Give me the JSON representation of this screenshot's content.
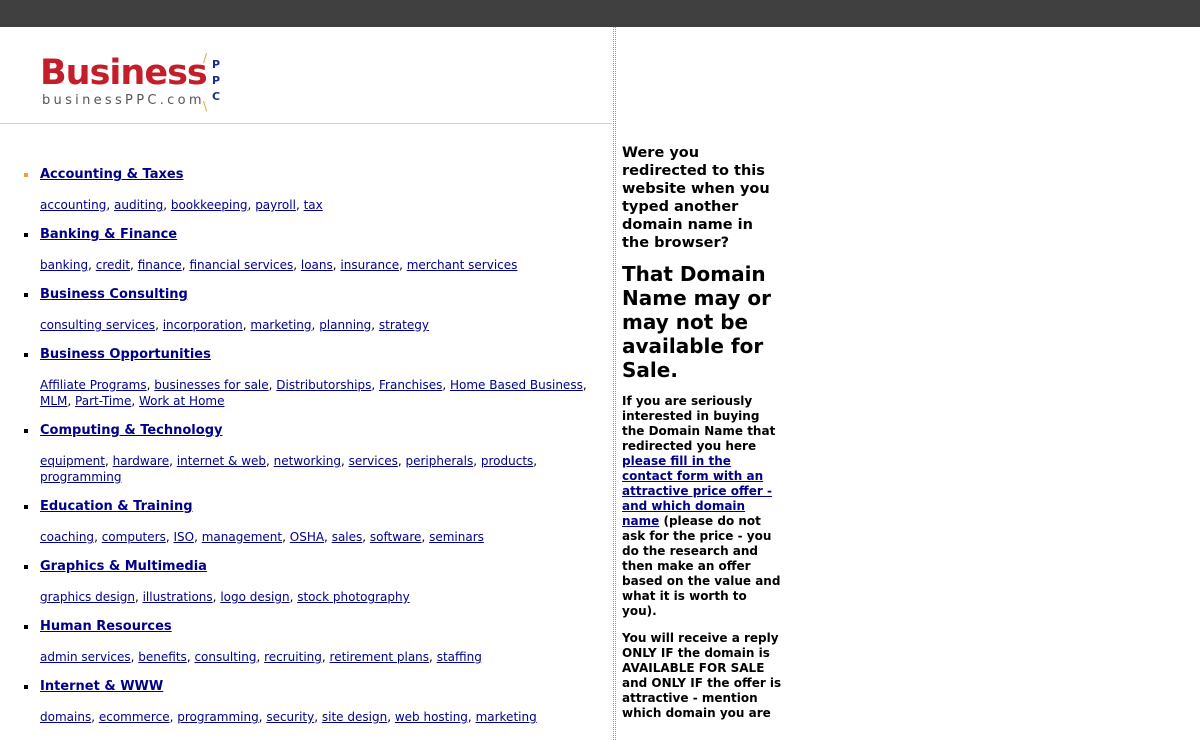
{
  "logo": {
    "brand": "Business",
    "domain": "businessPPC.com",
    "ppc": [
      "P",
      "P",
      "C"
    ]
  },
  "categories": [
    {
      "title": "Accounting & Taxes",
      "keywords": [
        "accounting",
        "auditing",
        "bookkeeping",
        "payroll",
        "tax"
      ]
    },
    {
      "title": "Banking & Finance",
      "keywords": [
        "banking",
        "credit",
        "finance",
        "financial services",
        "loans",
        "insurance",
        "merchant services"
      ]
    },
    {
      "title": "Business Consulting",
      "keywords": [
        "consulting services",
        "incorporation",
        "marketing",
        "planning",
        "strategy"
      ]
    },
    {
      "title": "Business Opportunities",
      "keywords": [
        "Affiliate Programs",
        "businesses for sale",
        "Distributorships",
        "Franchises",
        "Home Based Business",
        "MLM",
        "Part-Time",
        "Work at Home"
      ]
    },
    {
      "title": "Computing & Technology",
      "keywords": [
        "equipment",
        "hardware",
        "internet & web",
        "networking",
        "services",
        "peripherals",
        "products",
        "programming"
      ]
    },
    {
      "title": "Education & Training",
      "keywords": [
        "coaching",
        "computers",
        "ISO",
        "management",
        "OSHA",
        "sales",
        "software",
        "seminars"
      ]
    },
    {
      "title": "Graphics & Multimedia",
      "keywords": [
        "graphics design",
        "illustrations",
        "logo design",
        "stock photography"
      ]
    },
    {
      "title": "Human Resources",
      "keywords": [
        "admin services",
        "benefits",
        "consulting",
        "recruiting",
        "retirement plans",
        "staffing"
      ]
    },
    {
      "title": "Internet & WWW",
      "keywords": [
        "domains",
        "ecommerce",
        "programming",
        "security",
        "site design",
        "web hosting",
        "marketing"
      ]
    }
  ],
  "sidebar": {
    "question": "Were you redirected to this website when you typed another domain name in the browser?",
    "headline": "That Domain Name may or may not be available for Sale.",
    "para1_before": "If you are seriously interested in buying the Domain Name that redirected you here ",
    "para1_link": "please fill in the contact form with an attractive price offer - and which domain name",
    "para1_after": " (please do not ask for the price - you do the research and then make an offer based on the value and what it is worth to you).",
    "para2": "You will receive a reply ONLY IF the domain is AVAILABLE FOR SALE and ONLY IF the offer is attractive - mention which domain you are"
  },
  "colors": {
    "brand_red": "#c41e2a",
    "link_blue": "#00008b",
    "topbar": "#404040",
    "first_bullet": "#e8a33a"
  }
}
